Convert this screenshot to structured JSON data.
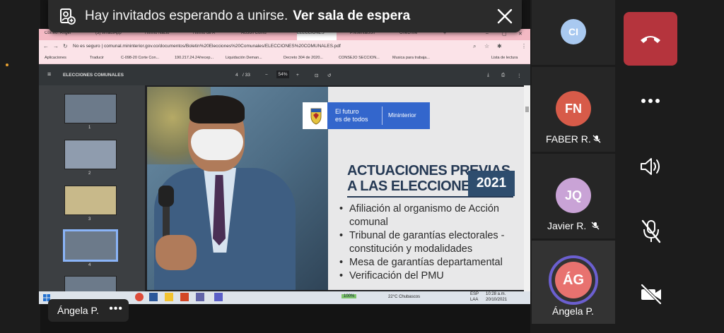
{
  "banner": {
    "text": "Hay invitados esperando a unirse.",
    "link": "Ver sala de espera"
  },
  "browser": {
    "tabs": [
      "Correo: Ángel",
      "(3) WhatsApp",
      "Himno Nacio",
      "Himno de A",
      "Acción Comu",
      "ELECCIONES",
      "Presentación",
      "OneDrive"
    ],
    "url": "No es seguro  |  comunal.mininterior.gov.co/documentos/Boletin%20Elecciones%20Comunales/ELECCIONES%20COMUNALES.pdf",
    "bookmarks": [
      "Aplicaciones",
      "Traducir",
      "C-098-20 Corte Con...",
      "190.217.24.24/recep...",
      "Liquidación Deman...",
      "Decreto 304 de 2020...",
      "CONSEJO SECCION...",
      "Musica para trabaja...",
      "Lista de lectura"
    ]
  },
  "pdf": {
    "title": "ELECCIONES COMUNALES",
    "page": "4",
    "pages": "/ 33",
    "zoom": "54%",
    "thumb_numbers": [
      "1",
      "2",
      "3",
      "4"
    ]
  },
  "slide": {
    "logo_line1": "El futuro",
    "logo_line2": "es de todos",
    "logo_ministry": "Mininterior",
    "title_line1": "ACTUACIONES PREVIAS",
    "title_line2": "A LAS ELECCIONES",
    "year": "2021",
    "bullets": [
      "Afiliación al organismo de Acción comunal",
      "Tribunal de garantías electorales - constitución y modalidades",
      "Mesa de garantías departamental",
      "Verificación del PMU"
    ]
  },
  "taskbar": {
    "battery": "100%",
    "weather": "22°C  Chubascos",
    "lang1": "ESP",
    "lang2": "LAA",
    "time": "10:28 a.m.",
    "date": "20/10/2021"
  },
  "presenter": {
    "name": "Ángela P."
  },
  "participants": [
    {
      "initials": "CI",
      "name": "",
      "color": "#a9c9f0"
    },
    {
      "initials": "FN",
      "name": "FABER R.",
      "color": "#d75b49"
    },
    {
      "initials": "JQ",
      "name": "Javier R.",
      "color": "#c9a3d6"
    },
    {
      "initials": "ÁG",
      "name": "Ángela P.",
      "color": "#e8726f"
    }
  ],
  "colors": {
    "end_call": "#b5343d",
    "speaking_ring": "#6b5fd0",
    "tile_bg": "#262626"
  },
  "icons": [
    "waiting-room-icon",
    "close-icon",
    "end-call-icon",
    "more-icon",
    "speaker-icon",
    "mic-off-icon",
    "camera-off-icon"
  ]
}
